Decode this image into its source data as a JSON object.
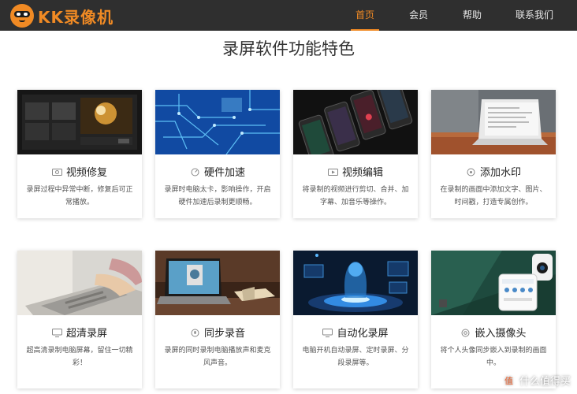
{
  "header": {
    "logo_text": "KK录像机",
    "nav": [
      {
        "label": "首页",
        "active": true
      },
      {
        "label": "会员",
        "active": false
      },
      {
        "label": "帮助",
        "active": false
      },
      {
        "label": "联系我们",
        "active": false
      }
    ],
    "accent_color": "#f08a24",
    "bar_color": "#2f2f2f"
  },
  "main": {
    "title": "录屏软件功能特色",
    "features": [
      {
        "title": "视频修复",
        "icon": "video-repair-icon",
        "desc": "录屏过程中异常中断，修复后可正常播放。"
      },
      {
        "title": "硬件加速",
        "icon": "hardware-accel-icon",
        "desc": "录屏时电脑太卡，影响操作，开启硬件加速后录制更顺畅。"
      },
      {
        "title": "视频编辑",
        "icon": "video-edit-icon",
        "desc": "将录制的视频进行剪切、合并、加字幕、加音乐等操作。"
      },
      {
        "title": "添加水印",
        "icon": "watermark-icon",
        "desc": "在录制的画面中添加文字、图片、时间戳，打造专属创作。"
      },
      {
        "title": "超清录屏",
        "icon": "hd-screen-icon",
        "desc": "超高清录制电脑屏幕，留住一切精彩！"
      },
      {
        "title": "同步录音",
        "icon": "sync-audio-icon",
        "desc": "录屏的同时录制电脑播放声和麦克风声音。"
      },
      {
        "title": "自动化录屏",
        "icon": "auto-record-icon",
        "desc": "电脑开机自动录屏、定时录屏、分段录屏等。"
      },
      {
        "title": "嵌入摄像头",
        "icon": "camera-icon",
        "desc": "将个人头像同步嵌入到录制的画面中。"
      }
    ]
  },
  "watermark": {
    "text": "什么值得买"
  }
}
